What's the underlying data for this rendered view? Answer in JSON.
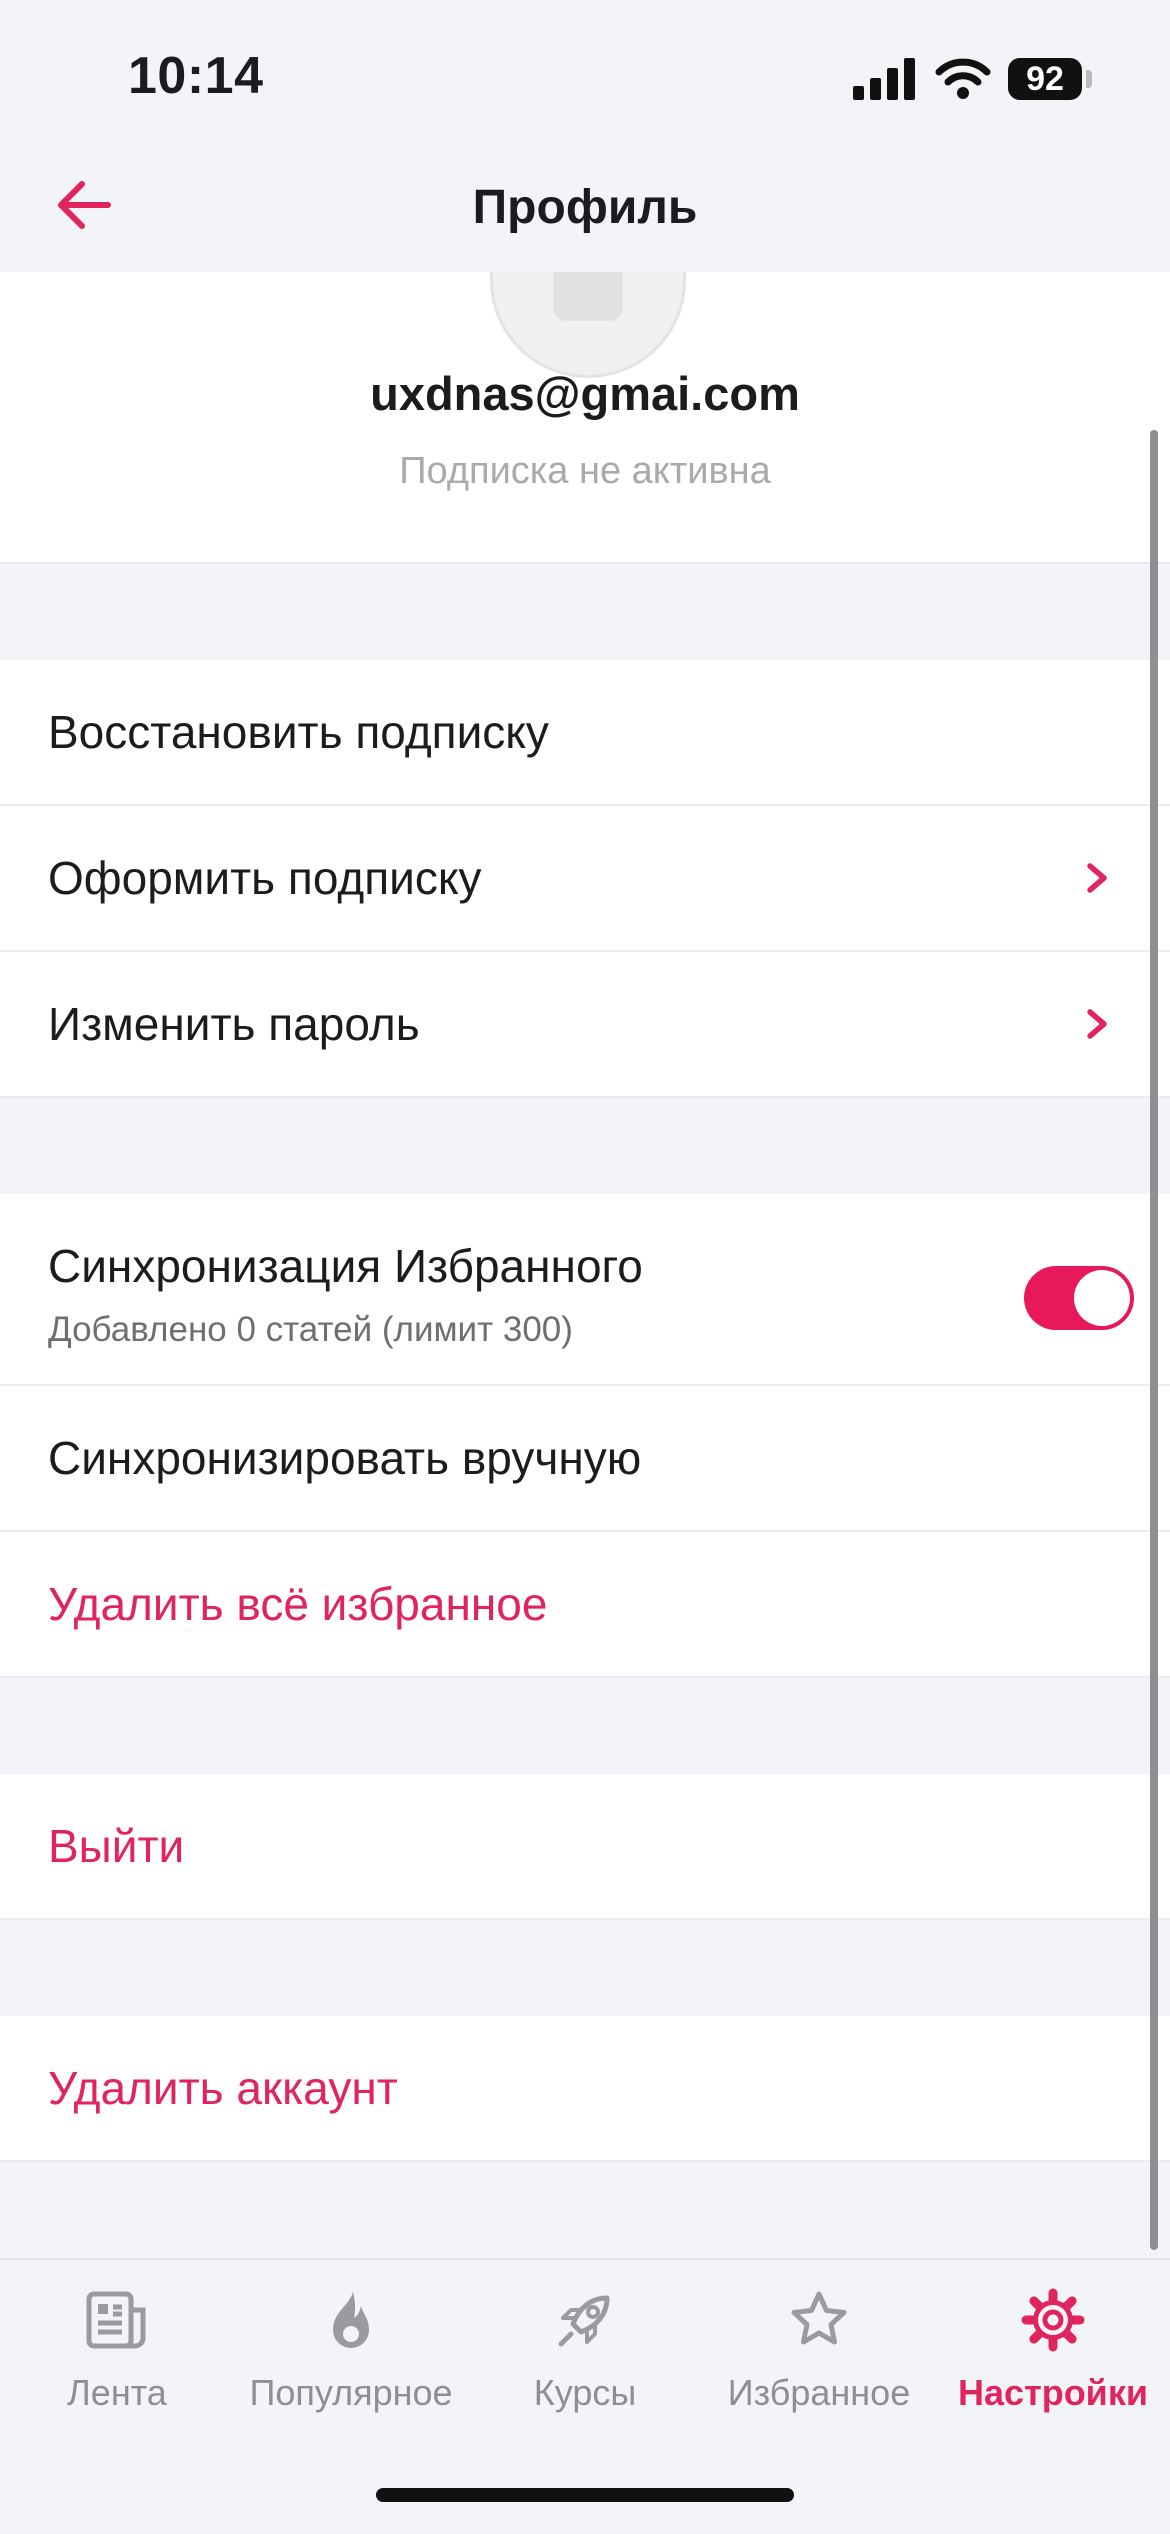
{
  "status": {
    "time": "10:14",
    "battery": "92"
  },
  "nav": {
    "title": "Профиль"
  },
  "profile": {
    "email": "uxdnas@gmai.com",
    "subscription_status": "Подписка не активна"
  },
  "subscription": {
    "restore": "Восстановить подписку",
    "subscribe": "Оформить подписку",
    "change_password": "Изменить пароль"
  },
  "favorites": {
    "sync_title": "Синхронизация Избранного",
    "sync_subtitle": "Добавлено 0 статей (лимит 300)",
    "sync_enabled": true,
    "sync_manual": "Синхронизировать вручную",
    "delete_all": "Удалить всё избранное"
  },
  "account": {
    "logout": "Выйти",
    "delete": "Удалить аккаунт"
  },
  "tabs": [
    {
      "label": "Лента",
      "icon": "newspaper-icon"
    },
    {
      "label": "Популярное",
      "icon": "flame-icon"
    },
    {
      "label": "Курсы",
      "icon": "rocket-icon"
    },
    {
      "label": "Избранное",
      "icon": "star-icon"
    },
    {
      "label": "Настройки",
      "icon": "gear-icon",
      "active": true
    }
  ],
  "colors": {
    "accent": "#e0245e",
    "background": "#f3f4f7",
    "inactive": "#8e8e93"
  }
}
